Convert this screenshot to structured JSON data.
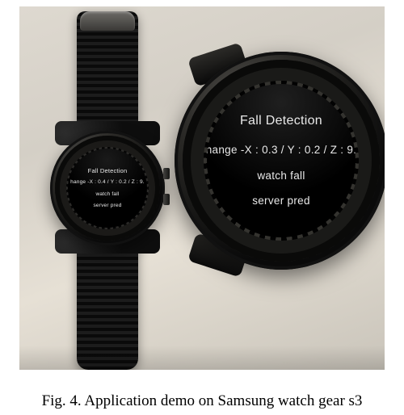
{
  "caption": "Fig. 4.    Application demo on Samsung watch gear s3",
  "watch_left": {
    "title": "Fall Detection",
    "line1": "hange -X : 0.4 / Y : 0.2 / Z : 9.",
    "line2": "watch fall",
    "line3": "server pred"
  },
  "watch_right": {
    "title": "Fall Detection",
    "line1": "hange -X : 0.3 / Y : 0.2 / Z : 9.",
    "line2": "watch fall",
    "line3": "server pred"
  }
}
